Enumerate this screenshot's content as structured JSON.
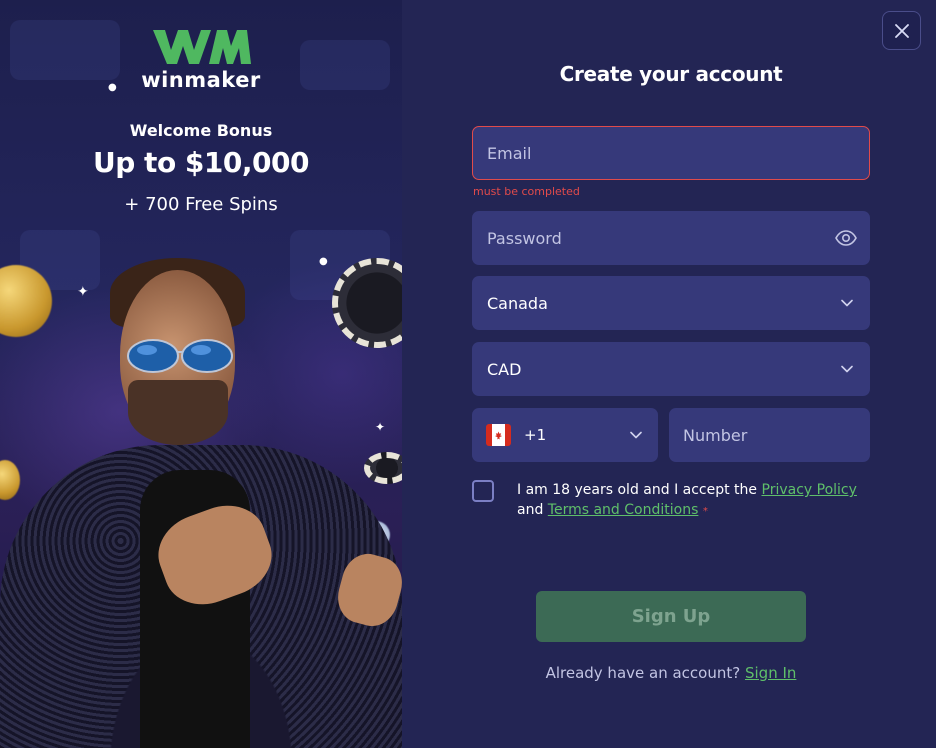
{
  "promo": {
    "brand": "winmaker",
    "welcome": "Welcome Bonus",
    "bonus": "Up to $10,000",
    "spins": "+ 700 Free Spins"
  },
  "form": {
    "title": "Create your account",
    "email_placeholder": "Email",
    "email_error": "must be completed",
    "password_placeholder": "Password",
    "country_value": "Canada",
    "currency_value": "CAD",
    "phone_code": "+1",
    "number_placeholder": "Number",
    "consent_text_1": "I am 18 years old and I accept the",
    "privacy_link": "Privacy Policy",
    "consent_and": "and",
    "terms_link": "Terms and Conditions",
    "required_mark": "*",
    "signup_label": "Sign Up",
    "have_account": "Already have an account?",
    "signin_link": "Sign In"
  },
  "colors": {
    "panel_bg": "#232554",
    "field_bg": "#36397a",
    "accent_green": "#5fbf6a",
    "error_red": "#e14b4b",
    "signup_bg": "#3c6a55"
  },
  "icons": {
    "close": "close-icon",
    "eye": "eye-icon",
    "chevron": "chevron-down-icon",
    "flag": "canada-flag-icon"
  }
}
